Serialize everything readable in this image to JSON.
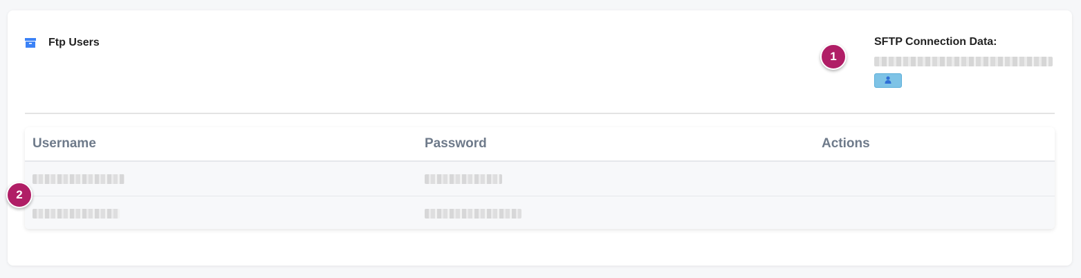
{
  "panel": {
    "title": "Ftp Users",
    "icon": "archive-box-icon",
    "accent_color": "#3b82f6"
  },
  "sftp": {
    "label": "SFTP Connection Data:",
    "value": "",
    "user_button_icon": "user-icon"
  },
  "markers": {
    "m1": "1",
    "m2": "2"
  },
  "table": {
    "headers": [
      "Username",
      "Password",
      "Actions"
    ],
    "rows": [
      {
        "username": "",
        "password": ""
      },
      {
        "username": "",
        "password": ""
      }
    ]
  }
}
